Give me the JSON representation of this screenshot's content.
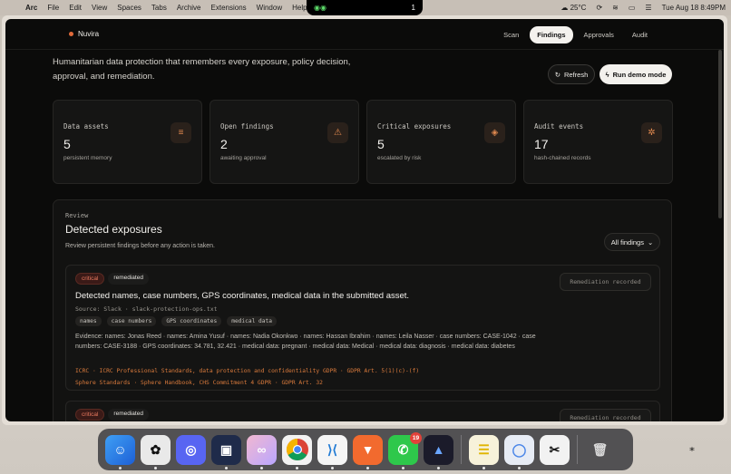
{
  "menubar": {
    "app": "Arc",
    "items": [
      "File",
      "Edit",
      "View",
      "Spaces",
      "Tabs",
      "Archive",
      "Extensions",
      "Window",
      "Help"
    ],
    "notch_count": "1",
    "weather": "25°C",
    "datetime": "Tue Aug 18  8:49PM"
  },
  "app": {
    "brand": "Nuvira",
    "nav": [
      "Scan",
      "Findings",
      "Approvals",
      "Audit"
    ],
    "active_tab": "Findings",
    "hero_text": "Humanitarian data protection that remembers every exposure, policy decision, approval, and remediation.",
    "refresh_label": "Refresh",
    "demo_label": "Run demo mode",
    "stats": [
      {
        "label": "Data assets",
        "value": "5",
        "sub": "persistent memory",
        "icon": "database-icon",
        "glyph": "≡"
      },
      {
        "label": "Open findings",
        "value": "2",
        "sub": "awaiting approval",
        "icon": "warning-icon",
        "glyph": "⚠"
      },
      {
        "label": "Critical exposures",
        "value": "5",
        "sub": "escalated by risk",
        "icon": "shield-icon",
        "glyph": "◈"
      },
      {
        "label": "Audit events",
        "value": "17",
        "sub": "hash-chained records",
        "icon": "fingerprint-icon",
        "glyph": "✲"
      }
    ],
    "review": {
      "eyebrow": "Review",
      "title": "Detected exposures",
      "desc": "Review persistent findings before any action is taken.",
      "filter": "All findings"
    },
    "findings": [
      {
        "severity": "critical",
        "status": "remediated",
        "action": "Remediation recorded",
        "title": "Detected names, case numbers, GPS coordinates, medical data in the submitted asset.",
        "source": "Source: Slack · slack-protection-ops.txt",
        "chips": [
          "names",
          "case numbers",
          "GPS coordinates",
          "medical data"
        ],
        "evidence": "Evidence: names: Jonas Reed · names: Amina Yusuf · names: Nadia Okonkwo · names: Hassan Ibrahim · names: Leila Nasser · case numbers: CASE-1042 · case numbers: CASE-3188 · GPS coordinates: 34.781, 32.421 · medical data: pregnant · medical data: Medical · medical data: diagnosis · medical data: diabetes",
        "ref1": "ICRC · ICRC Professional Standards, data protection and confidentiality GDPR · GDPR Art. 5(1)(c)-(f)",
        "ref2": "Sphere Standards · Sphere Handbook, CHS Commitment 4 GDPR · GDPR Art. 32"
      },
      {
        "severity": "critical",
        "status": "remediated",
        "action": "Remediation recorded"
      }
    ]
  },
  "dock": {
    "apps": [
      "Finder",
      "ChatGPT",
      "Discord",
      "Screenshot",
      "Arc",
      "Chrome",
      "VS Code",
      "Brave",
      "WhatsApp",
      "Arc Search",
      "Notes",
      "Mirror",
      "CapCut",
      "Trash"
    ],
    "whatsapp_badge": "19"
  }
}
